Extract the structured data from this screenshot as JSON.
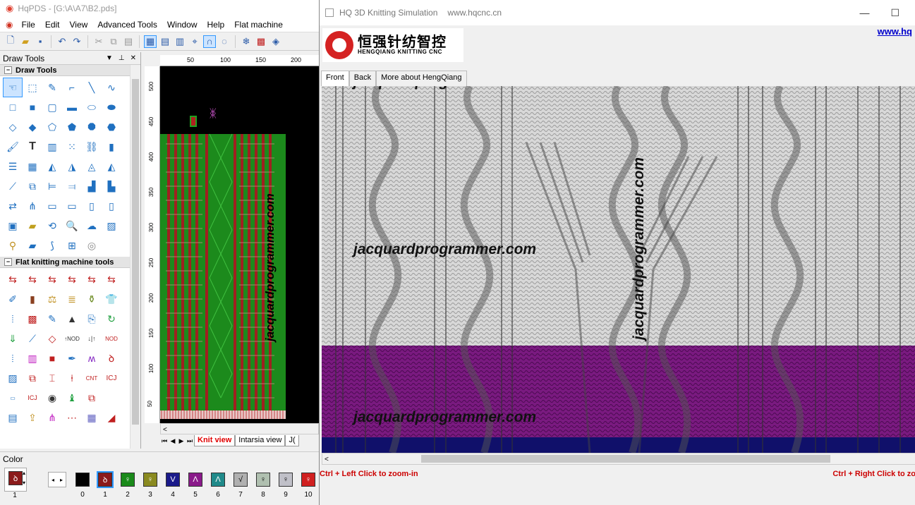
{
  "main": {
    "title": "HqPDS - [G:\\A\\A7\\B2.pds]",
    "menu": [
      "File",
      "Edit",
      "View",
      "Advanced Tools",
      "Window",
      "Help",
      "Flat machine"
    ],
    "draw_panel_title": "Draw Tools",
    "group_draw": "Draw Tools",
    "group_flat": "Flat knitting machine tools",
    "ruler_h": [
      "50",
      "100",
      "150",
      "200"
    ],
    "ruler_v": [
      "500",
      "450",
      "400",
      "350",
      "300",
      "250",
      "200",
      "150",
      "100",
      "50"
    ],
    "tabs": [
      "Knit view",
      "Intarsia view",
      "J("
    ],
    "watermark": "jacquardprogrammer.com",
    "color_label": "Color",
    "current_color_num": "1",
    "swatches": [
      {
        "num": "0",
        "color": "#000000",
        "glyph": ""
      },
      {
        "num": "1",
        "color": "#8b1a1a",
        "glyph": "ꝺ"
      },
      {
        "num": "2",
        "color": "#1a8a1a",
        "glyph": "♀"
      },
      {
        "num": "3",
        "color": "#8a8a20",
        "glyph": "♀"
      },
      {
        "num": "4",
        "color": "#1a1a8a",
        "glyph": "V"
      },
      {
        "num": "5",
        "color": "#8a1a8a",
        "glyph": "Λ"
      },
      {
        "num": "6",
        "color": "#208a8a",
        "glyph": "Λ"
      },
      {
        "num": "7",
        "color": "#b0b0b0",
        "glyph": "√"
      },
      {
        "num": "8",
        "color": "#b0c0b0",
        "glyph": "♀"
      },
      {
        "num": "9",
        "color": "#c0c0c8",
        "glyph": "♀"
      },
      {
        "num": "10",
        "color": "#d02020",
        "glyph": "♀"
      }
    ]
  },
  "sim": {
    "title": "HQ 3D Knitting Simulation",
    "url": "www.hqcnc.cn",
    "logo_cn": "恒强针纺智控",
    "logo_en": "HENGQIANG KNITTING CNC",
    "link": "www.hq",
    "tabs": [
      "Front",
      "Back",
      "More about HengQiang"
    ],
    "watermark": "jacquardprogrammer.com",
    "status_left": "Ctrl + Left Click to zoom-in",
    "status_right": "Ctrl + Right Click to zo"
  }
}
